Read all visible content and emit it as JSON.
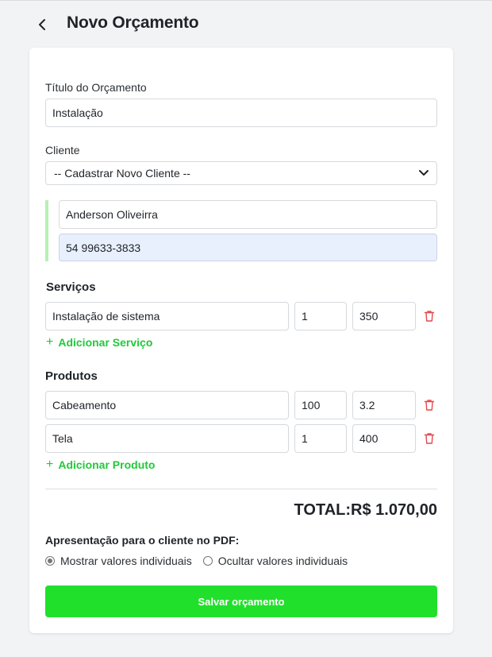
{
  "header": {
    "title": "Novo Orçamento"
  },
  "form": {
    "title_label": "Título do Orçamento",
    "title_value": "Instalação",
    "client_label": "Cliente",
    "client_select": "-- Cadastrar Novo Cliente --",
    "client_name": "Anderson Oliveirra",
    "client_phone": "54 99633-3833"
  },
  "services": {
    "title": "Serviços",
    "items": [
      {
        "description": "Instalação de sistema",
        "quantity": "1",
        "price": "350"
      }
    ],
    "add_label": "Adicionar Serviço"
  },
  "products": {
    "title": "Produtos",
    "items": [
      {
        "description": "Cabeamento",
        "quantity": "100",
        "price": "3.2"
      },
      {
        "description": "Tela",
        "quantity": "1",
        "price": "400"
      }
    ],
    "add_label": "Adicionar Produto"
  },
  "summary": {
    "total": "TOTAL:R$ 1.070,00"
  },
  "presentation": {
    "label": "Apresentação para o cliente no PDF:",
    "options": [
      {
        "label": "Mostrar valores individuais",
        "selected": true
      },
      {
        "label": "Ocultar valores individuais",
        "selected": false
      }
    ]
  },
  "actions": {
    "save_label": "Salvar orçamento"
  },
  "colors": {
    "accent": "#21e02b",
    "link": "#22c83a",
    "danger": "#e5484d",
    "background": "#f2f3f5"
  }
}
